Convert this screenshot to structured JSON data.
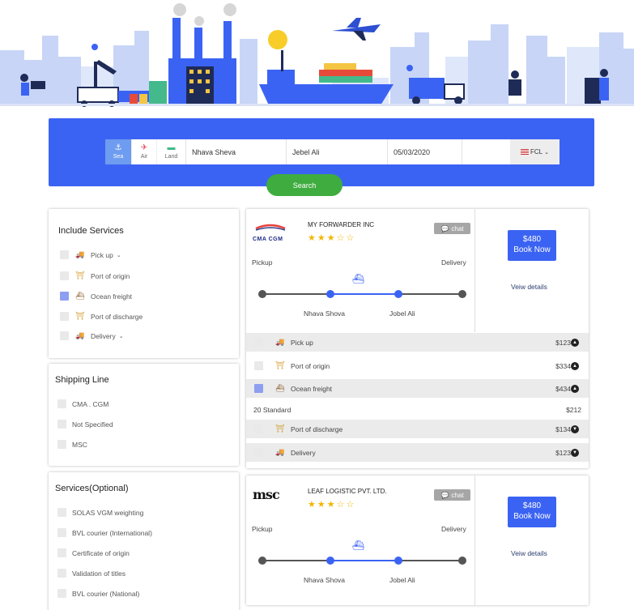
{
  "search": {
    "tabs": [
      {
        "label": "Sea",
        "icon": "anchor-icon",
        "active": true
      },
      {
        "label": "Air",
        "icon": "airplane-icon",
        "active": false
      },
      {
        "label": "Land",
        "icon": "truck-icon",
        "active": false
      }
    ],
    "origin": "Nhava Sheva",
    "destination": "Jebel Ali",
    "date": "05/03/2020",
    "load_type": "FCL",
    "button": "Search"
  },
  "filters": {
    "include_services": {
      "title": "Include Services",
      "items": [
        {
          "label": "Pick up",
          "checked": false,
          "dropdown": true,
          "icon": "truck-icon"
        },
        {
          "label": "Port of origin",
          "checked": false,
          "dropdown": false,
          "icon": "crane-icon"
        },
        {
          "label": "Ocean freight",
          "checked": true,
          "dropdown": false,
          "icon": "ship-icon"
        },
        {
          "label": "Port of discharge",
          "checked": false,
          "dropdown": false,
          "icon": "crane-icon"
        },
        {
          "label": "Delivery",
          "checked": false,
          "dropdown": true,
          "icon": "truck-icon"
        }
      ]
    },
    "shipping_line": {
      "title": "Shipping Line",
      "items": [
        "CMA . CGM",
        "Not Specified",
        "MSC"
      ]
    },
    "services_optional": {
      "title": "Services(Optional)",
      "items": [
        "SOLAS VGM weighting",
        "BVL courier (International)",
        "Certificate of origin",
        "Validation of titles",
        "BVL courier (National)"
      ]
    }
  },
  "results": [
    {
      "logo": "CMA CGM",
      "name": "MY FORWARDER INC",
      "rating": 3,
      "chat": "chat",
      "pickup_label": "Pickup",
      "delivery_label": "Delivery",
      "origin": "Nhava Shova",
      "destination": "Jobel Ali",
      "price": "$480",
      "book": "Book Now",
      "view": "Veiw details",
      "services": [
        {
          "label": "Pick up",
          "price": "$123",
          "checked": false,
          "icon": "truck-icon",
          "expand": "up"
        },
        {
          "label": "Port of origin",
          "price": "$334",
          "checked": false,
          "icon": "crane-icon",
          "expand": "up"
        },
        {
          "label": "Ocean freight",
          "price": "$434",
          "checked": true,
          "icon": "ship-icon",
          "expand": "up"
        },
        {
          "label": "Port of discharge",
          "price": "$134",
          "checked": false,
          "icon": "crane-icon",
          "expand": "down"
        },
        {
          "label": "Delivery",
          "price": "$123",
          "checked": false,
          "icon": "truck-icon",
          "expand": "down"
        }
      ],
      "sub_row": {
        "label": "20 Standard",
        "price": "$212"
      }
    },
    {
      "logo": "msc",
      "name": "LEAF LOGISTIC PVT. LTD.",
      "rating": 3,
      "chat": "chat",
      "pickup_label": "Pickup",
      "delivery_label": "Delivery",
      "origin": "Nhava Shova",
      "destination": "Jobel Ali",
      "price": "$480",
      "book": "Book Now",
      "view": "Veiw details"
    }
  ],
  "colors": {
    "primary": "#3b63f3",
    "search_button": "#3fac3f",
    "star": "#f2b600",
    "checked": "#8e9ef0"
  }
}
